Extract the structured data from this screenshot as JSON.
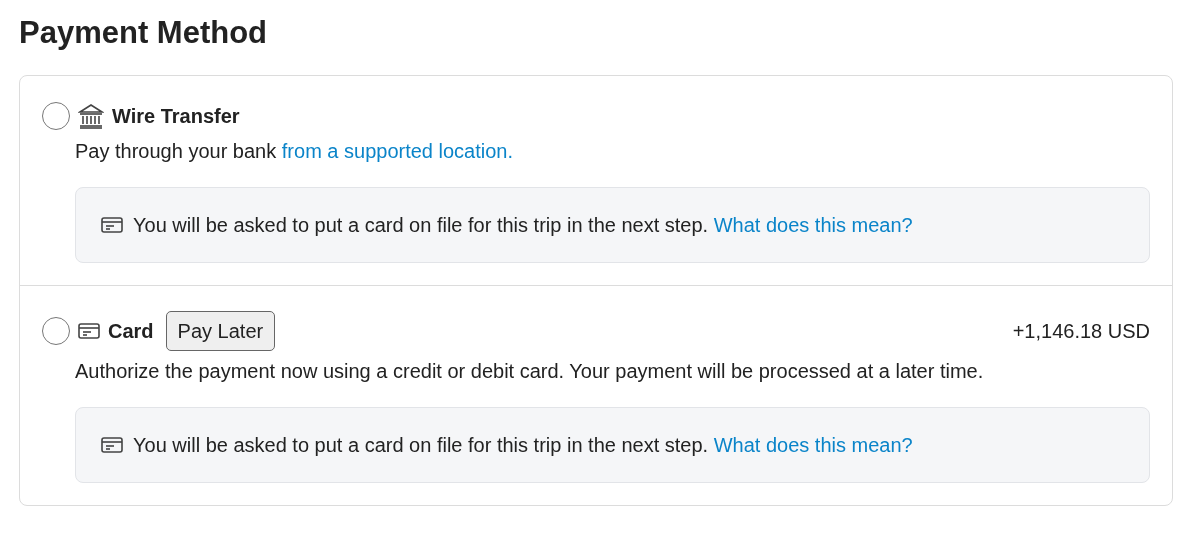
{
  "title": "Payment Method",
  "options": [
    {
      "kind": "bank",
      "label": "Wire Transfer",
      "selected": false,
      "description": "Pay through your bank ",
      "description_link": "from a supported location.",
      "notice": "You will be asked to put a card on file for this trip in the next step. ",
      "notice_link": "What does this mean?"
    },
    {
      "kind": "card",
      "label": "Card",
      "selected": false,
      "tag": "Pay Later",
      "amount": "+1,146.18 USD",
      "description": "Authorize the payment now using a credit or debit card. Your payment will be processed at a later time.",
      "notice": "You will be asked to put a card on file for this trip in the next step. ",
      "notice_link": "What does this mean?"
    }
  ]
}
